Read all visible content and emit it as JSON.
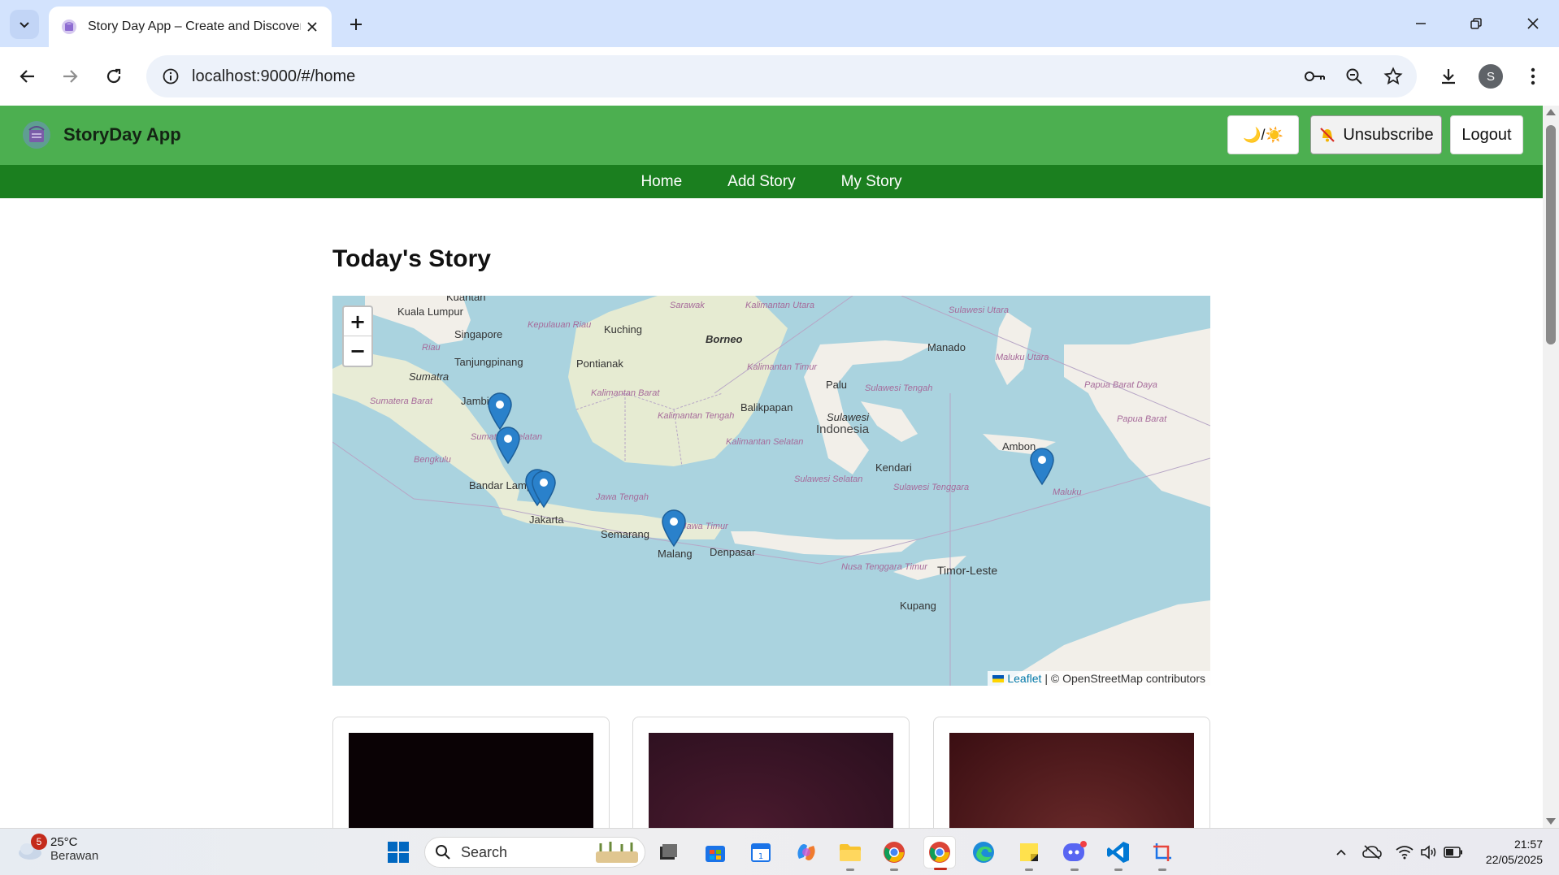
{
  "browser": {
    "tab_title": "Story Day App – Create and Discover Stories",
    "url": "localhost:9000/#/home",
    "profile_initial": "S"
  },
  "app": {
    "brand": "StoryDay App",
    "theme_toggle_label": "🌙/☀️",
    "unsubscribe_label": "Unsubscribe",
    "logout_label": "Logout",
    "nav": [
      {
        "label": "Home"
      },
      {
        "label": "Add Story"
      },
      {
        "label": "My Story"
      }
    ],
    "page_title": "Today's Story"
  },
  "map": {
    "zoom_in": "+",
    "zoom_out": "−",
    "attribution_link": "Leaflet",
    "attribution_text": "| © OpenStreetMap contributors",
    "labels": {
      "kuantan": "Kuantan",
      "kuala_lumpur": "Kuala Lumpur",
      "singapore": "Singapore",
      "tanjungpinang": "Tanjungpinang",
      "kepulauan_riau": "Kepulauan Riau",
      "riau": "Riau",
      "kuching": "Kuching",
      "sarawak": "Sarawak",
      "borneo": "Borneo",
      "kalimantan_utara": "Kalimantan Utara",
      "sulawesi_utara": "Sulawesi Utara",
      "manado": "Manado",
      "maluku_utara": "Maluku Utara",
      "sumatra": "Sumatra",
      "pontianak": "Pontianak",
      "kalimantan_timur": "Kalimantan Timur",
      "palu": "Palu",
      "sulawesi_tengah": "Sulawesi Tengah",
      "papua_barat_daya": "Papua Barat Daya",
      "papua_barat": "Papua Barat",
      "sumatera_barat": "Sumatera Barat",
      "jambi": "Jambi",
      "kalimantan_barat": "Kalimantan Barat",
      "balikpapan": "Balikpapan",
      "sulawesi": "Sulawesi",
      "indonesia": "Indonesia",
      "kalimantan_tengah": "Kalimantan Tengah",
      "sumatera_selatan": "Sumatera Selatan",
      "kalimantan_selatan": "Kalimantan Selatan",
      "ambon": "Ambon",
      "bengkulu": "Bengkulu",
      "kendari": "Kendari",
      "bandar_lampung": "Bandar Lampung",
      "sulawesi_selatan": "Sulawesi Selatan",
      "sulawesi_tenggara": "Sulawesi Tenggara",
      "maluku": "Maluku",
      "jawa_tengah": "Jawa Tengah",
      "jakarta": "Jakarta",
      "semarang": "Semarang",
      "jawa_timur": "Jawa Timur",
      "malang": "Malang",
      "denpasar": "Denpasar",
      "nusa_tenggara_timur": "Nusa Tenggara Timur",
      "timor_leste": "Timor-Leste",
      "kupang": "Kupang"
    }
  },
  "taskbar": {
    "weather_temp": "25°C",
    "weather_desc": "Berawan",
    "weather_badge": "5",
    "search_label": "Search",
    "time": "21:57",
    "date": "22/05/2025"
  },
  "colors": {
    "header": "#4caf50",
    "nav": "#1b7f1f",
    "map_water": "#aad3df",
    "map_land": "#f2efe9",
    "marker": "#2a81cb"
  }
}
